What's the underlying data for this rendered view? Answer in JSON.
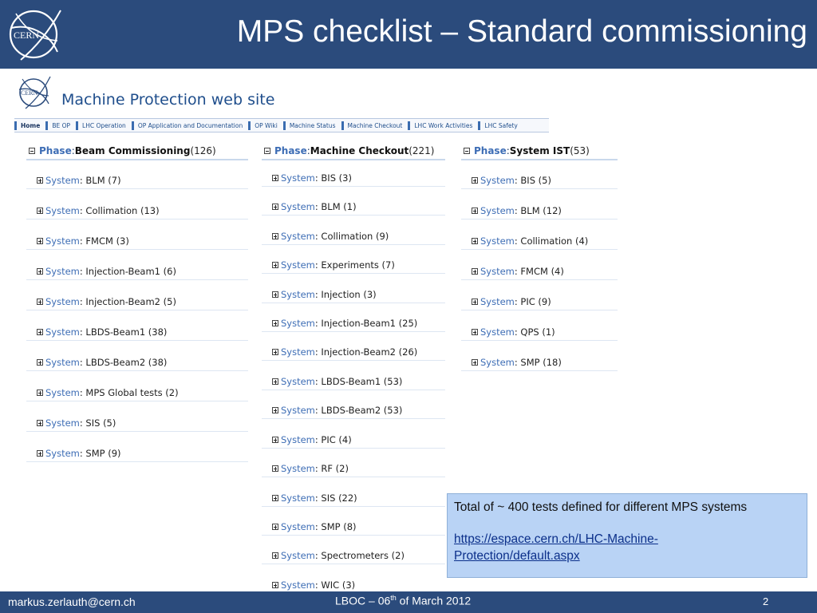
{
  "slide": {
    "title": "MPS checklist – Standard commissioning",
    "logo_text": "CERN",
    "footer_email": "markus.zerlauth@cern.ch",
    "footer_date_prefix": "LBOC – 06",
    "footer_date_sup": "th",
    "footer_date_suffix": " of March 2012",
    "page_number": "2"
  },
  "site": {
    "logo_text": "CERN",
    "title": "Machine Protection web site",
    "nav": [
      "Home",
      "BE OP",
      "LHC Operation",
      "OP Application and Documentation",
      "OP Wiki",
      "Machine Status",
      "Machine Checkout",
      "LHC Work Activities",
      "LHC Safety"
    ]
  },
  "phases": [
    {
      "prefix": "Phase",
      "separator": " : ",
      "name": "Beam Commissioning",
      "count": " (126)",
      "systems": [
        {
          "prefix": "System",
          "name": " : BLM (7)"
        },
        {
          "prefix": "System",
          "name": " : Collimation (13)"
        },
        {
          "prefix": "System",
          "name": " : FMCM (3)"
        },
        {
          "prefix": "System",
          "name": " : Injection-Beam1 (6)"
        },
        {
          "prefix": "System",
          "name": " : Injection-Beam2 (5)"
        },
        {
          "prefix": "System",
          "name": " : LBDS-Beam1 (38)"
        },
        {
          "prefix": "System",
          "name": " : LBDS-Beam2 (38)"
        },
        {
          "prefix": "System",
          "name": " : MPS Global tests (2)"
        },
        {
          "prefix": "System",
          "name": " : SIS (5)"
        },
        {
          "prefix": "System",
          "name": " : SMP (9)"
        }
      ]
    },
    {
      "prefix": "Phase",
      "separator": " : ",
      "name": "Machine Checkout",
      "count": " (221)",
      "systems": [
        {
          "prefix": "System",
          "name": " : BIS (3)"
        },
        {
          "prefix": "System",
          "name": " : BLM (1)"
        },
        {
          "prefix": "System",
          "name": " : Collimation (9)"
        },
        {
          "prefix": "System",
          "name": " : Experiments (7)"
        },
        {
          "prefix": "System",
          "name": " : Injection (3)"
        },
        {
          "prefix": "System",
          "name": " : Injection-Beam1 (25)"
        },
        {
          "prefix": "System",
          "name": " : Injection-Beam2 (26)"
        },
        {
          "prefix": "System",
          "name": " : LBDS-Beam1 (53)"
        },
        {
          "prefix": "System",
          "name": " : LBDS-Beam2 (53)"
        },
        {
          "prefix": "System",
          "name": " : PIC (4)"
        },
        {
          "prefix": "System",
          "name": " : RF (2)"
        },
        {
          "prefix": "System",
          "name": " : SIS (22)"
        },
        {
          "prefix": "System",
          "name": " : SMP (8)"
        },
        {
          "prefix": "System",
          "name": " : Spectrometers (2)"
        },
        {
          "prefix": "System",
          "name": " : WIC (3)"
        }
      ]
    },
    {
      "prefix": "Phase",
      "separator": " : ",
      "name": "System IST",
      "count": " (53)",
      "systems": [
        {
          "prefix": "System",
          "name": " : BIS (5)"
        },
        {
          "prefix": "System",
          "name": " : BLM (12)"
        },
        {
          "prefix": "System",
          "name": " : Collimation (4)"
        },
        {
          "prefix": "System",
          "name": " : FMCM (4)"
        },
        {
          "prefix": "System",
          "name": " : PIC (9)"
        },
        {
          "prefix": "System",
          "name": " : QPS (1)"
        },
        {
          "prefix": "System",
          "name": " : SMP (18)"
        }
      ]
    }
  ],
  "info": {
    "total_text": "Total of ~ 400 tests defined for different MPS systems",
    "link_line1": "https://espace.cern.ch/LHC-Machine-",
    "link_line2": "Protection/default.aspx"
  }
}
